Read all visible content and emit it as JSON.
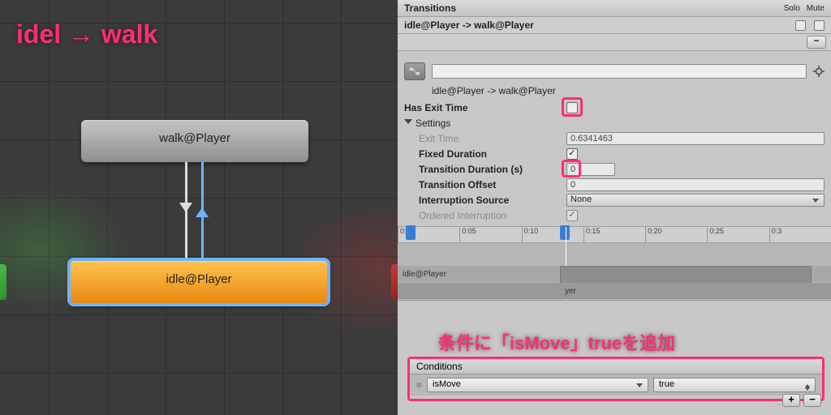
{
  "annotations": {
    "title": "idel → walk",
    "conditions_note": "条件に「isMove」trueを追加"
  },
  "graph": {
    "walk_node": "walk@Player",
    "idle_node": "idle@Player"
  },
  "inspector": {
    "header": {
      "title": "Transitions",
      "solo_label": "Solo",
      "mute_label": "Mute",
      "selected": "idle@Player -> walk@Player",
      "minus": "−"
    },
    "transition_name": "idle@Player -> walk@Player",
    "props": {
      "has_exit_time": {
        "label": "Has Exit Time",
        "checked": false
      },
      "settings_label": "Settings",
      "exit_time": {
        "label": "Exit Time",
        "value": "0.6341463"
      },
      "fixed_duration": {
        "label": "Fixed Duration",
        "checked": true
      },
      "transition_duration": {
        "label": "Transition Duration (s)",
        "value": "0"
      },
      "transition_offset": {
        "label": "Transition Offset",
        "value": "0"
      },
      "interruption_source": {
        "label": "Interruption Source",
        "value": "None"
      },
      "ordered_interruption": {
        "label": "Ordered Interruption",
        "checked": true
      }
    },
    "timeline": {
      "ticks": [
        "0:00",
        "0:05",
        "0:10",
        "0:15",
        "0:20",
        "0:25",
        "0:3"
      ],
      "row1": "idle@Player",
      "row2_suffix": "yer"
    },
    "conditions": {
      "header": "Conditions",
      "rows": [
        {
          "param": "isMove",
          "value": "true"
        }
      ],
      "plus": "+",
      "minus": "−"
    }
  }
}
